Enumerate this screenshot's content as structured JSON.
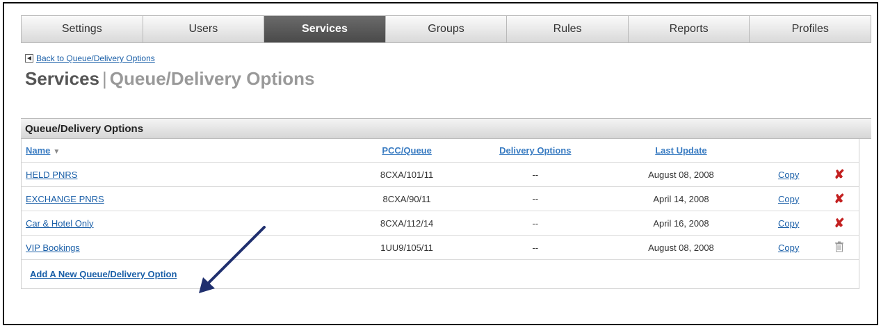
{
  "tabs": [
    "Settings",
    "Users",
    "Services",
    "Groups",
    "Rules",
    "Reports",
    "Profiles"
  ],
  "active_tab": "Services",
  "back_link": "Back to Queue/Delivery Options",
  "title": {
    "main": "Services",
    "separator": "|",
    "sub": "Queue/Delivery Options"
  },
  "panel": {
    "header": "Queue/Delivery Options",
    "columns": {
      "name": "Name",
      "pcc": "PCC/Queue",
      "delivery": "Delivery Options",
      "updated": "Last Update"
    },
    "rows": [
      {
        "name": "HELD PNRS",
        "pcc": "8CXA/101/11",
        "delivery": "--",
        "updated": "August 08, 2008",
        "copy": "Copy",
        "action": "delete"
      },
      {
        "name": "EXCHANGE PNRS",
        "pcc": "8CXA/90/11",
        "delivery": "--",
        "updated": "April 14, 2008",
        "copy": "Copy",
        "action": "delete"
      },
      {
        "name": "Car & Hotel Only",
        "pcc": "8CXA/112/14",
        "delivery": "--",
        "updated": "April 16, 2008",
        "copy": "Copy",
        "action": "delete"
      },
      {
        "name": "VIP Bookings",
        "pcc": "1UU9/105/11",
        "delivery": "--",
        "updated": "August 08, 2008",
        "copy": "Copy",
        "action": "trash"
      }
    ],
    "add_link": "Add A New Queue/Delivery Option"
  },
  "icons": {
    "sort": "sort-down-icon",
    "delete": "delete-x-icon",
    "trash": "trash-icon",
    "back": "back-arrow-icon"
  },
  "colors": {
    "link": "#1a5fa8",
    "active_tab": "#555555",
    "delete": "#c32020",
    "arrow": "#1f2f6e"
  }
}
